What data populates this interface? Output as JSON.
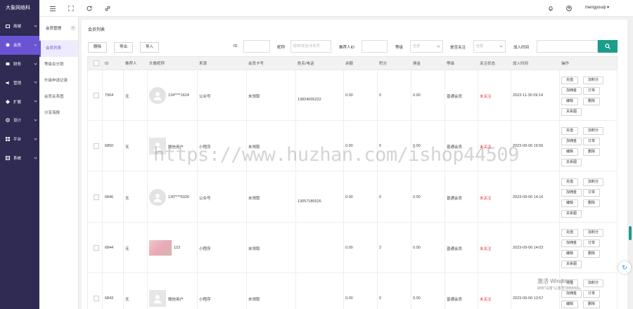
{
  "sidebar": {
    "logo": "大象网络科",
    "items": [
      {
        "label": "商城",
        "icon": "store-icon",
        "active": false
      },
      {
        "label": "会员",
        "icon": "member-icon",
        "active": true
      },
      {
        "label": "财务",
        "icon": "finance-icon",
        "active": false
      },
      {
        "label": "营销",
        "icon": "marketing-icon",
        "active": false
      },
      {
        "label": "扩展",
        "icon": "extension-icon",
        "active": false
      },
      {
        "label": "设计",
        "icon": "design-icon",
        "active": false
      },
      {
        "label": "平台",
        "icon": "platform-icon",
        "active": false
      },
      {
        "label": "系统",
        "icon": "system-icon",
        "active": false
      }
    ]
  },
  "subnav": {
    "title": "会员管理",
    "collapse_glyph": "«",
    "items": [
      {
        "label": "会员列表",
        "active": true
      },
      {
        "label": "等级及分销",
        "active": false
      },
      {
        "label": "升级申请记录",
        "active": false
      },
      {
        "label": "会员关系图",
        "active": false
      },
      {
        "label": "分享海报",
        "active": false
      }
    ]
  },
  "topbar": {
    "user": "mengyouqi",
    "icons": [
      "menu-icon",
      "fullscreen-icon",
      "refresh-icon",
      "link-icon",
      "bell-icon",
      "help-icon",
      "caret-down-icon"
    ]
  },
  "page": {
    "title": "会员列表",
    "buttons": {
      "delete": "删除",
      "export": "导出",
      "import": "导入"
    }
  },
  "filters": {
    "id_label": "ID",
    "id_value": "",
    "nickname_label": "昵称",
    "nickname_placeholder": "昵称/姓名/手机号",
    "referrer_label": "推荐人ID",
    "referrer_value": "",
    "level_label": "等级",
    "level_value": "全部",
    "follow_label": "是否关注",
    "follow_value": "全部",
    "jointime_label": "加入时间",
    "jointime_value": ""
  },
  "table": {
    "headers": [
      "ID",
      "推荐人",
      "头像昵称",
      "来源",
      "会员卡号",
      "姓名/电话",
      "余额",
      "积分",
      "佣金",
      "等级",
      "关注状态",
      "加入时间",
      "操作"
    ],
    "rows": [
      {
        "id": "7964",
        "referrer": "无",
        "avatar": "round",
        "nickname": "134****1624",
        "source": "公众号",
        "card": "未领取",
        "phone": "13824005222",
        "balance": "0.00",
        "points": "0",
        "commission": "0.00",
        "level": "普通会员",
        "follow": "未关注",
        "joined": "2023-11-30 09:14"
      },
      {
        "id": "6850",
        "referrer": "无",
        "avatar": "square",
        "nickname": "微信用户",
        "source": "小程序",
        "card": "未领取",
        "phone": "",
        "balance": "0.00",
        "points": "0",
        "commission": "0.00",
        "level": "普通会员",
        "follow": "未关注",
        "joined": "2023-09-06 16:56"
      },
      {
        "id": "6846",
        "referrer": "无",
        "avatar": "round",
        "nickname": "130****6326",
        "source": "公众号",
        "card": "未领取",
        "phone": "13057186526",
        "balance": "0.00",
        "points": "0",
        "commission": "0.00",
        "level": "普通会员",
        "follow": "未关注",
        "joined": "2023-09-06 14:16"
      },
      {
        "id": "6844",
        "referrer": "无",
        "avatar": "photo",
        "nickname": "123",
        "source": "小程序",
        "card": "未领取",
        "phone": "",
        "balance": "0.00",
        "points": "2",
        "commission": "0.00",
        "level": "普通会员",
        "follow": "未关注",
        "joined": "2023-09-06 14:03"
      },
      {
        "id": "6843",
        "referrer": "无",
        "avatar": "square",
        "nickname": "微信用户",
        "source": "小程序",
        "card": "未领取",
        "phone": "",
        "balance": "0.00",
        "points": "0",
        "commission": "0.00",
        "level": "普通会员",
        "follow": "未关注",
        "joined": "2023-09-06 13:57"
      }
    ],
    "ops": {
      "recharge": "充值",
      "add_points": "加积分",
      "add_commission": "加佣金",
      "orders": "订单",
      "edit": "编辑",
      "delete": "删除",
      "relation": "关系图"
    }
  },
  "watermark": "https://www.huzhan.com/ishop44509",
  "windows": {
    "activate": "激活 Windows",
    "sub": "转到\"设置\"以激活 Windows。"
  },
  "colors": {
    "sidebar": "#2f2b52",
    "active_nav": "#6a54d4",
    "primary": "#1c9c8a",
    "unfollowed": "#e03b3b"
  }
}
